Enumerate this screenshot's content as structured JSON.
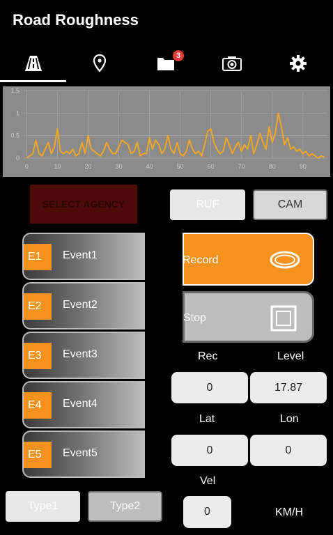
{
  "header": {
    "title": "Road Roughness"
  },
  "tabs": {
    "road_icon": "road-icon",
    "location_icon": "location-pin-icon",
    "folder_icon": "folder-icon",
    "folder_badge": "3",
    "camera_icon": "camera-icon",
    "settings_icon": "gear-icon"
  },
  "chart_data": {
    "type": "line",
    "x": [
      0,
      1,
      2,
      3,
      4,
      5,
      6,
      7,
      8,
      9,
      10,
      11,
      12,
      13,
      14,
      15,
      16,
      17,
      18,
      19,
      20,
      21,
      22,
      23,
      24,
      25,
      26,
      27,
      28,
      29,
      30,
      31,
      32,
      33,
      34,
      35,
      36,
      37,
      38,
      39,
      40,
      41,
      42,
      43,
      44,
      45,
      46,
      47,
      48,
      49,
      50,
      51,
      52,
      53,
      54,
      55,
      56,
      57,
      58,
      59,
      60,
      61,
      62,
      63,
      64,
      65,
      66,
      67,
      68,
      69,
      70,
      71,
      72,
      73,
      74,
      75,
      76,
      77,
      78,
      79,
      80,
      81,
      82,
      83,
      84,
      85,
      86,
      87,
      88,
      89,
      90,
      91,
      92,
      93,
      94,
      95,
      96,
      97
    ],
    "series": [
      {
        "values": [
          0,
          0.05,
          0.1,
          0.4,
          0.1,
          0.05,
          0.2,
          0.35,
          0.1,
          0.25,
          0.65,
          0.15,
          0.1,
          0.15,
          0.1,
          0.2,
          0.05,
          0.1,
          0.35,
          0.1,
          0.5,
          0.2,
          0.15,
          0.1,
          0.05,
          0.15,
          0.35,
          0.2,
          0.1,
          0.1,
          0.25,
          0.4,
          0.35,
          0.3,
          0.1,
          0.15,
          0.35,
          0.05,
          0.1,
          0.1,
          0.45,
          0.2,
          0.4,
          0.3,
          0.1,
          0.2,
          0.5,
          0.2,
          0.1,
          0.35,
          0.1,
          0.05,
          0.15,
          0.4,
          0.2,
          0.1,
          0.15,
          0.05,
          0.3,
          0.6,
          0.65,
          0.35,
          0.2,
          0.1,
          0.15,
          0.45,
          0.3,
          0.1,
          0.25,
          0.35,
          0.15,
          0.3,
          0.2,
          0.5,
          0.1,
          0.3,
          0.55,
          0.35,
          0.2,
          0.7,
          0.35,
          0.55,
          1.0,
          0.7,
          0.3,
          0.45,
          0.2,
          0.25,
          0.15,
          0.2,
          0.1,
          0.15,
          0.05,
          0.1,
          0.05,
          0.0,
          0.05,
          0.02
        ],
        "color": "#f5a623"
      }
    ],
    "xticks": [
      "0",
      "10",
      "20",
      "30",
      "40",
      "50",
      "60",
      "70",
      "80",
      "90"
    ],
    "yticks": [
      "0",
      "0.5",
      "1",
      "1.5"
    ],
    "xlim": [
      -1,
      98
    ],
    "ylim": [
      0,
      1.5
    ],
    "grid": true
  },
  "controls": {
    "select_agency": "SELECT AGENCY",
    "ruf": "RUF",
    "cam": "CAM",
    "record": "Record",
    "stop": "Stop",
    "type1": "Type1",
    "type2": "Type2"
  },
  "events": [
    {
      "code": "E1",
      "label": "Event1"
    },
    {
      "code": "E2",
      "label": "Event2"
    },
    {
      "code": "E3",
      "label": "Event3"
    },
    {
      "code": "E4",
      "label": "Event4"
    },
    {
      "code": "E5",
      "label": "Event5"
    }
  ],
  "readouts": {
    "rec_label": "Rec",
    "rec_value": "0",
    "level_label": "Level",
    "level_value": "17.87",
    "lat_label": "Lat",
    "lat_value": "0",
    "lon_label": "Lon",
    "lon_value": "0",
    "vel_label": "Vel",
    "vel_value": "0",
    "vel_unit": "KM/H"
  }
}
